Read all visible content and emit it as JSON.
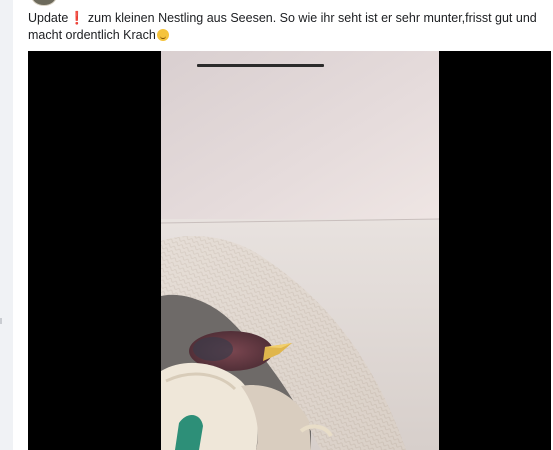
{
  "post": {
    "text_part1": "Update",
    "text_part2": "zum kleinen Nestling aus Seesen. So wie ihr seht ist er sehr munter,frisst gut und macht ordentlich Krach",
    "emoji_exclamation": "❗"
  }
}
